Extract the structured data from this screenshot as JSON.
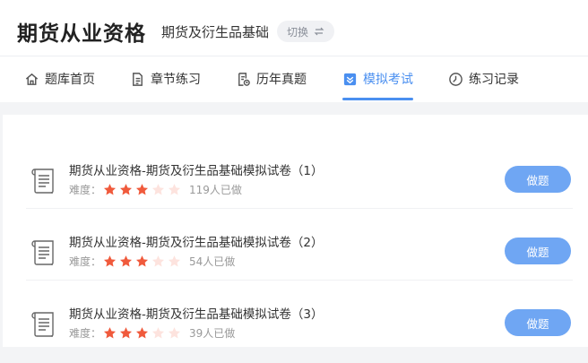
{
  "header": {
    "app_title": "期货从业资格",
    "subject": "期货及衍生品基础",
    "switch_label": "切换"
  },
  "tabs": [
    {
      "label": "题库首页",
      "icon": "home-icon",
      "active": false
    },
    {
      "label": "章节练习",
      "icon": "document-icon",
      "active": false
    },
    {
      "label": "历年真题",
      "icon": "past-papers-icon",
      "active": false
    },
    {
      "label": "模拟考试",
      "icon": "mock-exam-icon",
      "active": true
    },
    {
      "label": "练习记录",
      "icon": "clock-icon",
      "active": false
    }
  ],
  "colors": {
    "accent": "#4a8ff0",
    "button": "#6fa6f3",
    "star_on": "#f05a3c",
    "star_off": "#fde3de"
  },
  "exams": [
    {
      "title": "期货从业资格-期货及衍生品基础模拟试卷（1）",
      "difficulty_label": "难度：",
      "stars": 3,
      "max_stars": 5,
      "count": "119人已做",
      "button": "做题"
    },
    {
      "title": "期货从业资格-期货及衍生品基础模拟试卷（2）",
      "difficulty_label": "难度：",
      "stars": 3,
      "max_stars": 5,
      "count": "54人已做",
      "button": "做题"
    },
    {
      "title": "期货从业资格-期货及衍生品基础模拟试卷（3）",
      "difficulty_label": "难度：",
      "stars": 3,
      "max_stars": 5,
      "count": "39人已做",
      "button": "做题"
    }
  ]
}
